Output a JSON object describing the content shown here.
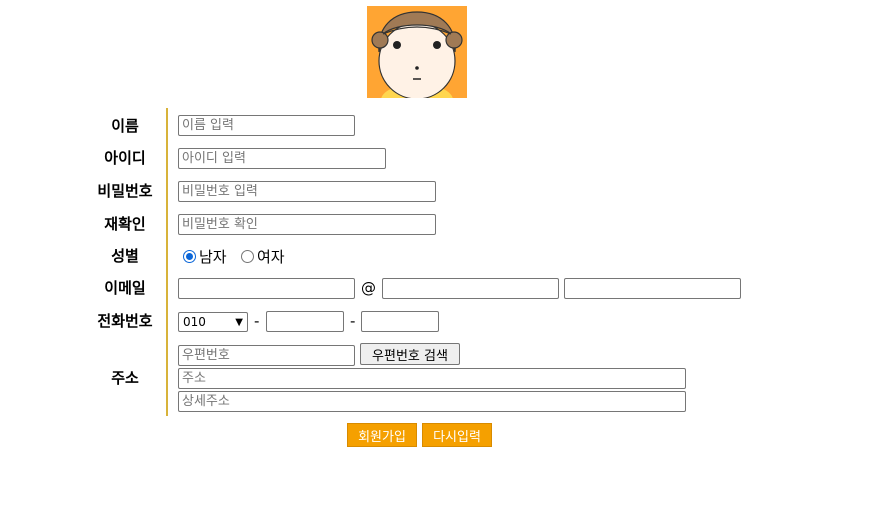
{
  "form": {
    "name": {
      "label": "이름",
      "placeholder": "이름 입력"
    },
    "userid": {
      "label": "아이디",
      "placeholder": "아이디 입력"
    },
    "pw": {
      "label": "비밀번호",
      "placeholder": "비밀번호 입력"
    },
    "pw_confirm": {
      "label": "재확인",
      "placeholder": "비밀번호 확인"
    },
    "gender": {
      "label": "성별",
      "options": [
        "남자",
        "여자"
      ],
      "selected": "남자"
    },
    "email": {
      "label": "이메일",
      "at": "@"
    },
    "phone": {
      "label": "전화번호",
      "prefix": "010",
      "dash": "-"
    },
    "address": {
      "label": "주소",
      "zip_placeholder": "우편번호",
      "search_button": "우편번호 검색",
      "addr_placeholder": "주소",
      "detail_placeholder": "상세주소"
    },
    "buttons": {
      "submit": "회원가입",
      "reset": "다시입력"
    }
  },
  "colors": {
    "accent_line": "#d8b33a",
    "button_orange": "#f5a000",
    "avatar_bg": "#ffa533"
  },
  "icons": {
    "avatar": "cartoon-face-avatar"
  }
}
